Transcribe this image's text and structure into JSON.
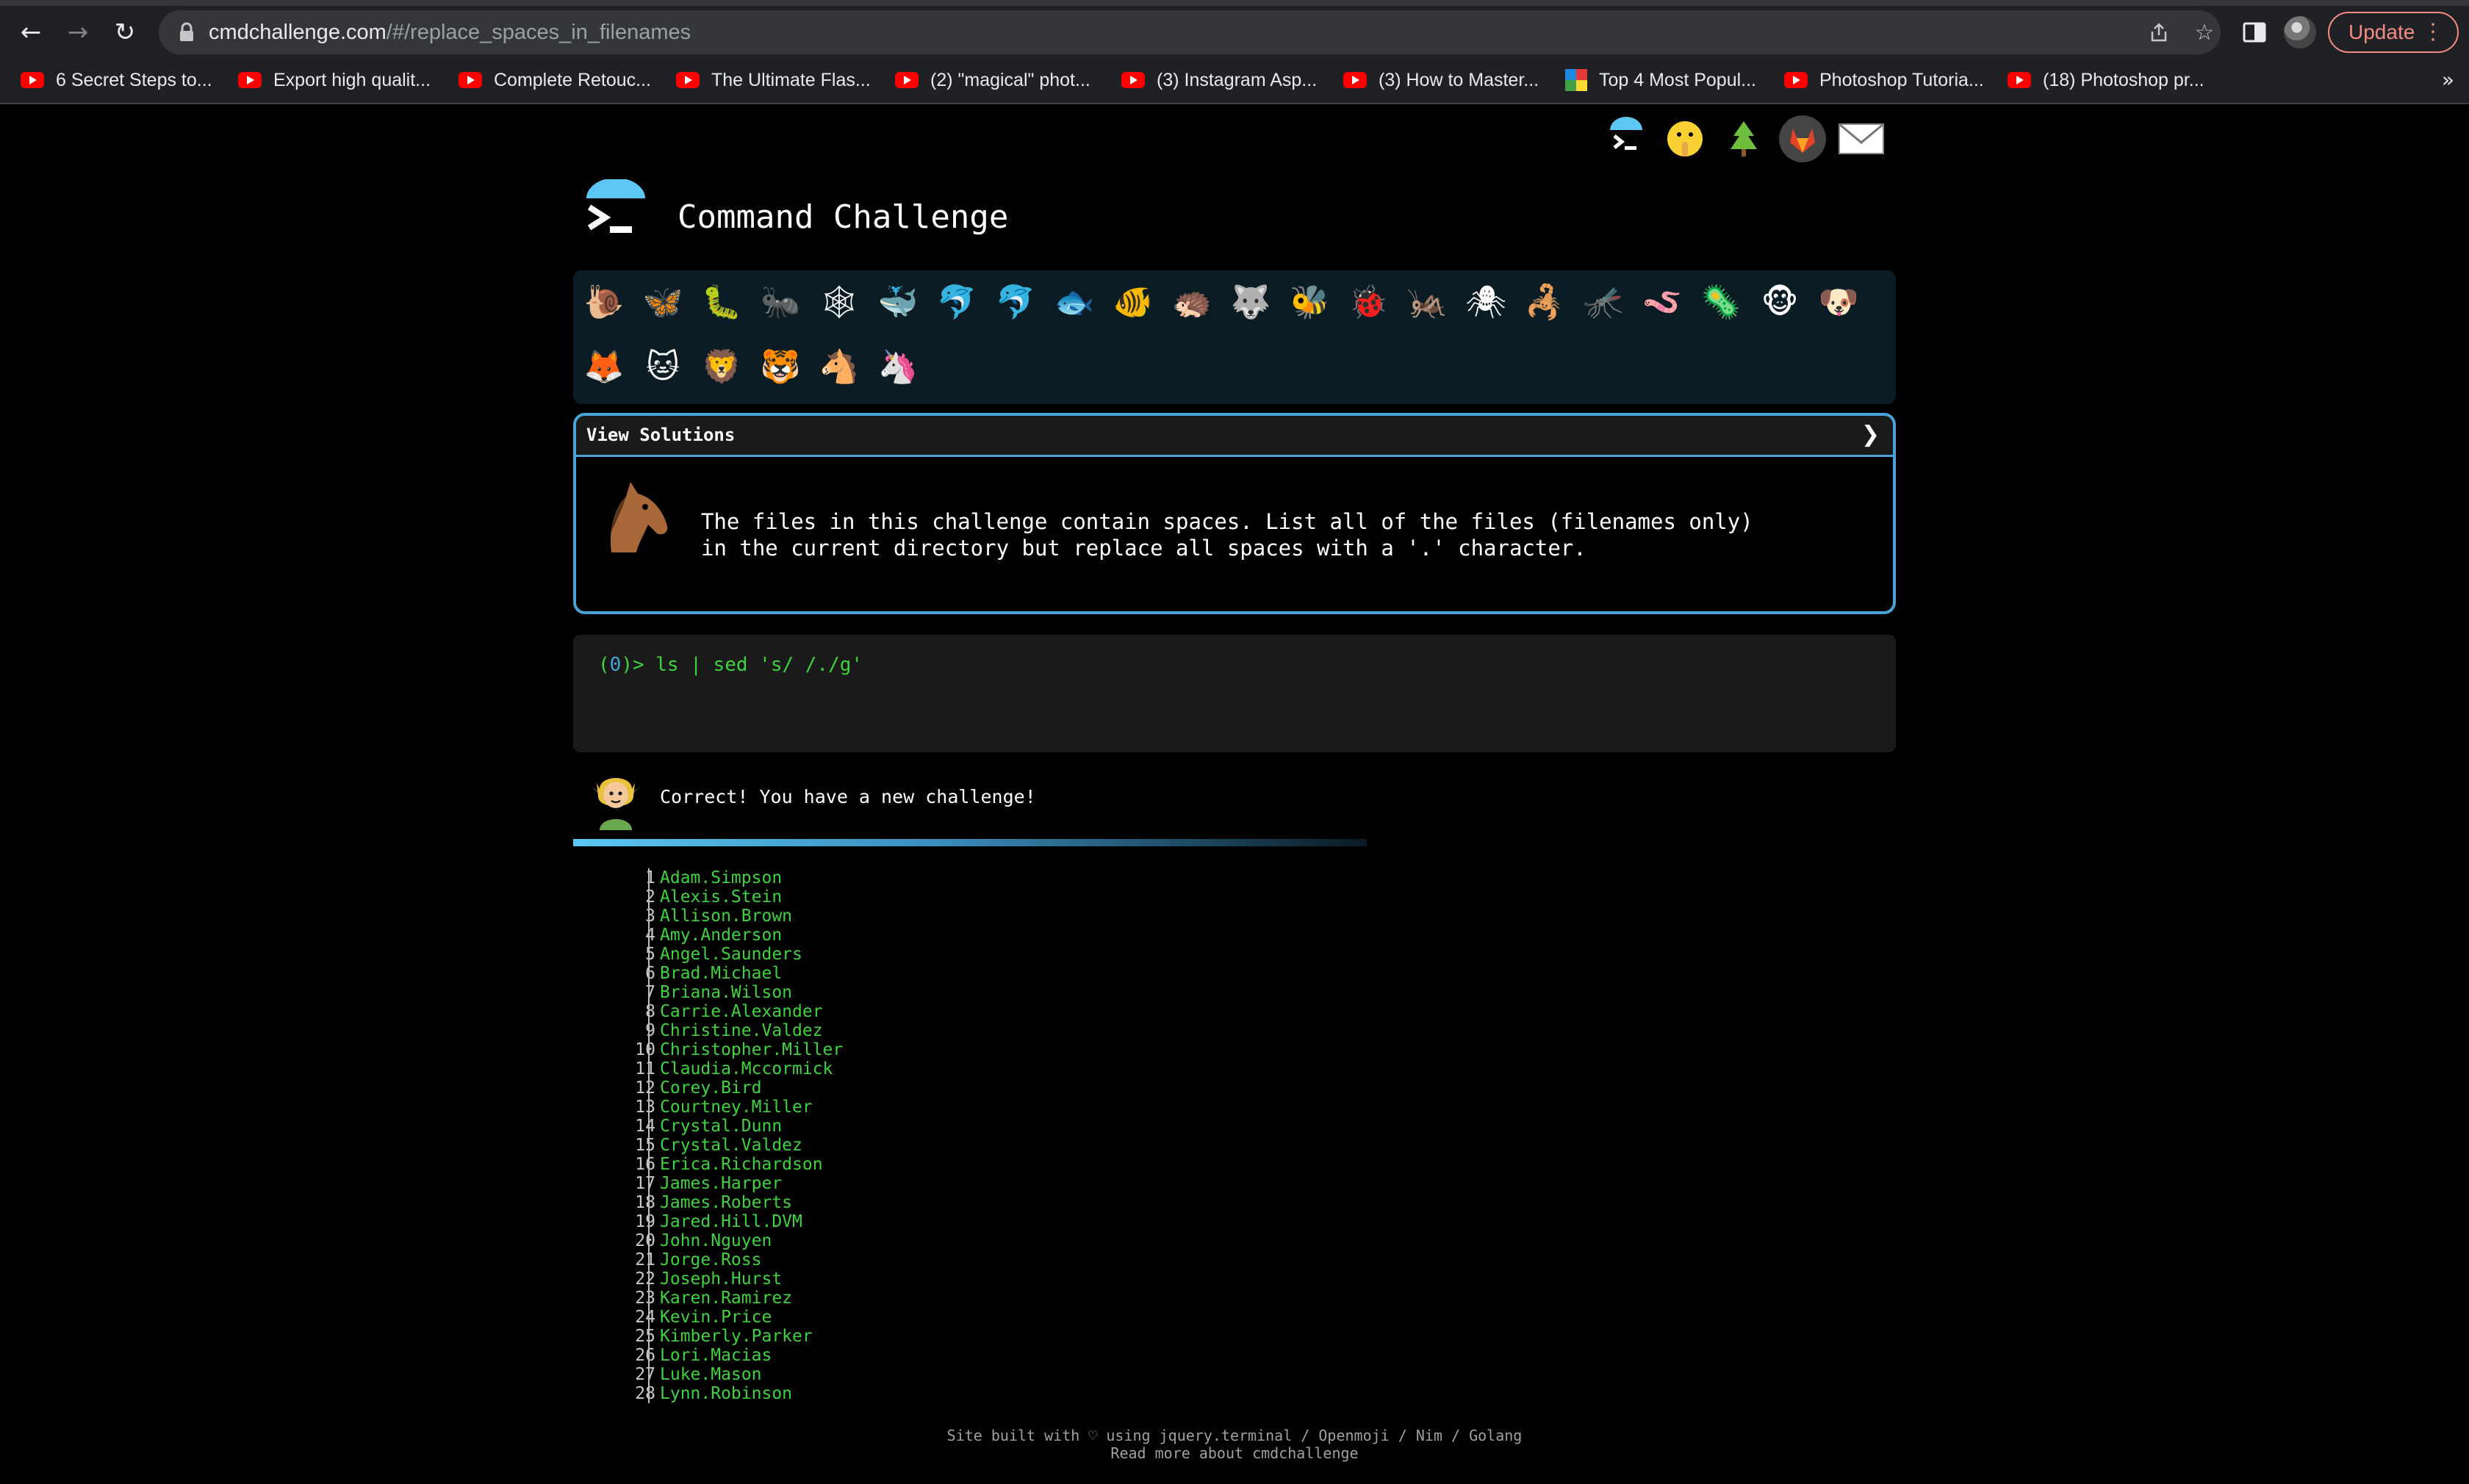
{
  "browser": {
    "url_host": "cmdchallenge.com",
    "url_path": "/#/replace_spaces_in_filenames",
    "update_label": "Update",
    "more_bookmarks": "»",
    "bookmarks": [
      {
        "label": "6 Secret Steps to...",
        "icon": "youtube-icon"
      },
      {
        "label": "Export high qualit...",
        "icon": "youtube-icon"
      },
      {
        "label": "Complete Retouc...",
        "icon": "youtube-icon"
      },
      {
        "label": "The Ultimate Flas...",
        "icon": "youtube-icon"
      },
      {
        "label": "(2) \"magical\" phot...",
        "icon": "youtube-icon"
      },
      {
        "label": "(3) Instagram Asp...",
        "icon": "youtube-icon"
      },
      {
        "label": "(3) How to Master...",
        "icon": "youtube-icon"
      },
      {
        "label": "Top 4 Most Popul...",
        "icon": "colorful-grid-icon"
      },
      {
        "label": "Photoshop Tutoria...",
        "icon": "youtube-icon"
      },
      {
        "label": "(18) Photoshop pr...",
        "icon": "youtube-icon"
      }
    ]
  },
  "header": {
    "title": "Command Challenge",
    "top_icons": [
      "terminal-logo-icon",
      "shushing-face-icon",
      "evergreen-tree-icon",
      "gitlab-icon",
      "mail-icon"
    ]
  },
  "emoji_bar": {
    "row1": [
      "🐌",
      "🦋",
      "🐛",
      "🐜",
      "🕸",
      "🐳",
      "🐬",
      "🐬",
      "🐟",
      "🐠",
      "🦔",
      "🐺",
      "🐝",
      "🐞",
      "🦗",
      "🕷",
      "🦂",
      "🦟",
      "🪱",
      "🦠",
      "🐵",
      "🐶"
    ],
    "row2": [
      "🦊",
      "🐱",
      "🦁",
      "🐯",
      "🐴",
      "🦄"
    ]
  },
  "challenge": {
    "view_solutions_label": "View Solutions",
    "view_solutions_arrow": "❯",
    "description_line1": "The files in this challenge contain spaces. List all of the files (filenames only)",
    "description_line2": "in the current directory but replace all spaces with a '.' character."
  },
  "terminal": {
    "prompt_open": "(",
    "prompt_num": "0",
    "prompt_close": ")> ",
    "command": "ls | sed 's/ /./g'"
  },
  "message": {
    "text": "Correct! You have a new challenge!"
  },
  "output": [
    "Adam.Simpson",
    "Alexis.Stein",
    "Allison.Brown",
    "Amy.Anderson",
    "Angel.Saunders",
    "Brad.Michael",
    "Briana.Wilson",
    "Carrie.Alexander",
    "Christine.Valdez",
    "Christopher.Miller",
    "Claudia.Mccormick",
    "Corey.Bird",
    "Courtney.Miller",
    "Crystal.Dunn",
    "Crystal.Valdez",
    "Erica.Richardson",
    "James.Harper",
    "James.Roberts",
    "Jared.Hill.DVM",
    "John.Nguyen",
    "Jorge.Ross",
    "Joseph.Hurst",
    "Karen.Ramirez",
    "Kevin.Price",
    "Kimberly.Parker",
    "Lori.Macias",
    "Luke.Mason",
    "Lynn.Robinson"
  ],
  "footer": {
    "line1": "Site built with ♡ using jquery.terminal / Openmoji / Nim / Golang",
    "line2": "Read more about cmdchallenge"
  }
}
